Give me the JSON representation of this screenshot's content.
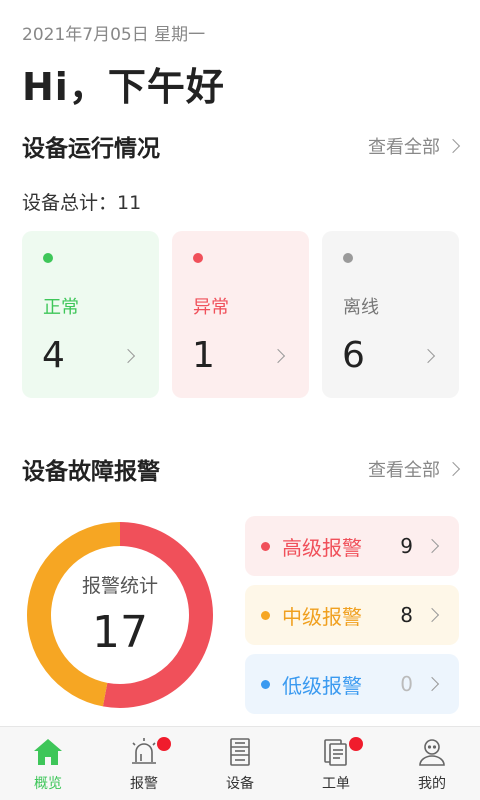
{
  "header": {
    "date": "2021年7月05日 星期一",
    "greeting": "Hi，下午好"
  },
  "devices": {
    "title": "设备运行情况",
    "view_all": "查看全部",
    "total_label": "设备总计：11",
    "cards": [
      {
        "label": "正常",
        "value": "4",
        "color": "#3ec659"
      },
      {
        "label": "异常",
        "value": "1",
        "color": "#f0505a"
      },
      {
        "label": "离线",
        "value": "6",
        "color": "#9a9a9a"
      }
    ]
  },
  "alarms": {
    "title": "设备故障报警",
    "view_all": "查看全部",
    "donut_label": "报警统计",
    "donut_total": "17",
    "items": [
      {
        "label": "高级报警",
        "count": 9,
        "color": "#f0505a"
      },
      {
        "label": "中级报警",
        "count": 8,
        "color": "#f6a623"
      },
      {
        "label": "低级报警",
        "count": 0,
        "color": "#3b9af0"
      }
    ]
  },
  "tabbar": {
    "items": [
      {
        "label": "概览",
        "icon": "home-icon",
        "active": true,
        "badge": false
      },
      {
        "label": "报警",
        "icon": "alarm-light-icon",
        "active": false,
        "badge": true
      },
      {
        "label": "设备",
        "icon": "server-icon",
        "active": false,
        "badge": false
      },
      {
        "label": "工单",
        "icon": "document-icon",
        "active": false,
        "badge": true
      },
      {
        "label": "我的",
        "icon": "user-icon",
        "active": false,
        "badge": false
      }
    ],
    "active_color": "#3ec659",
    "badge_color": "#f01c2c"
  }
}
